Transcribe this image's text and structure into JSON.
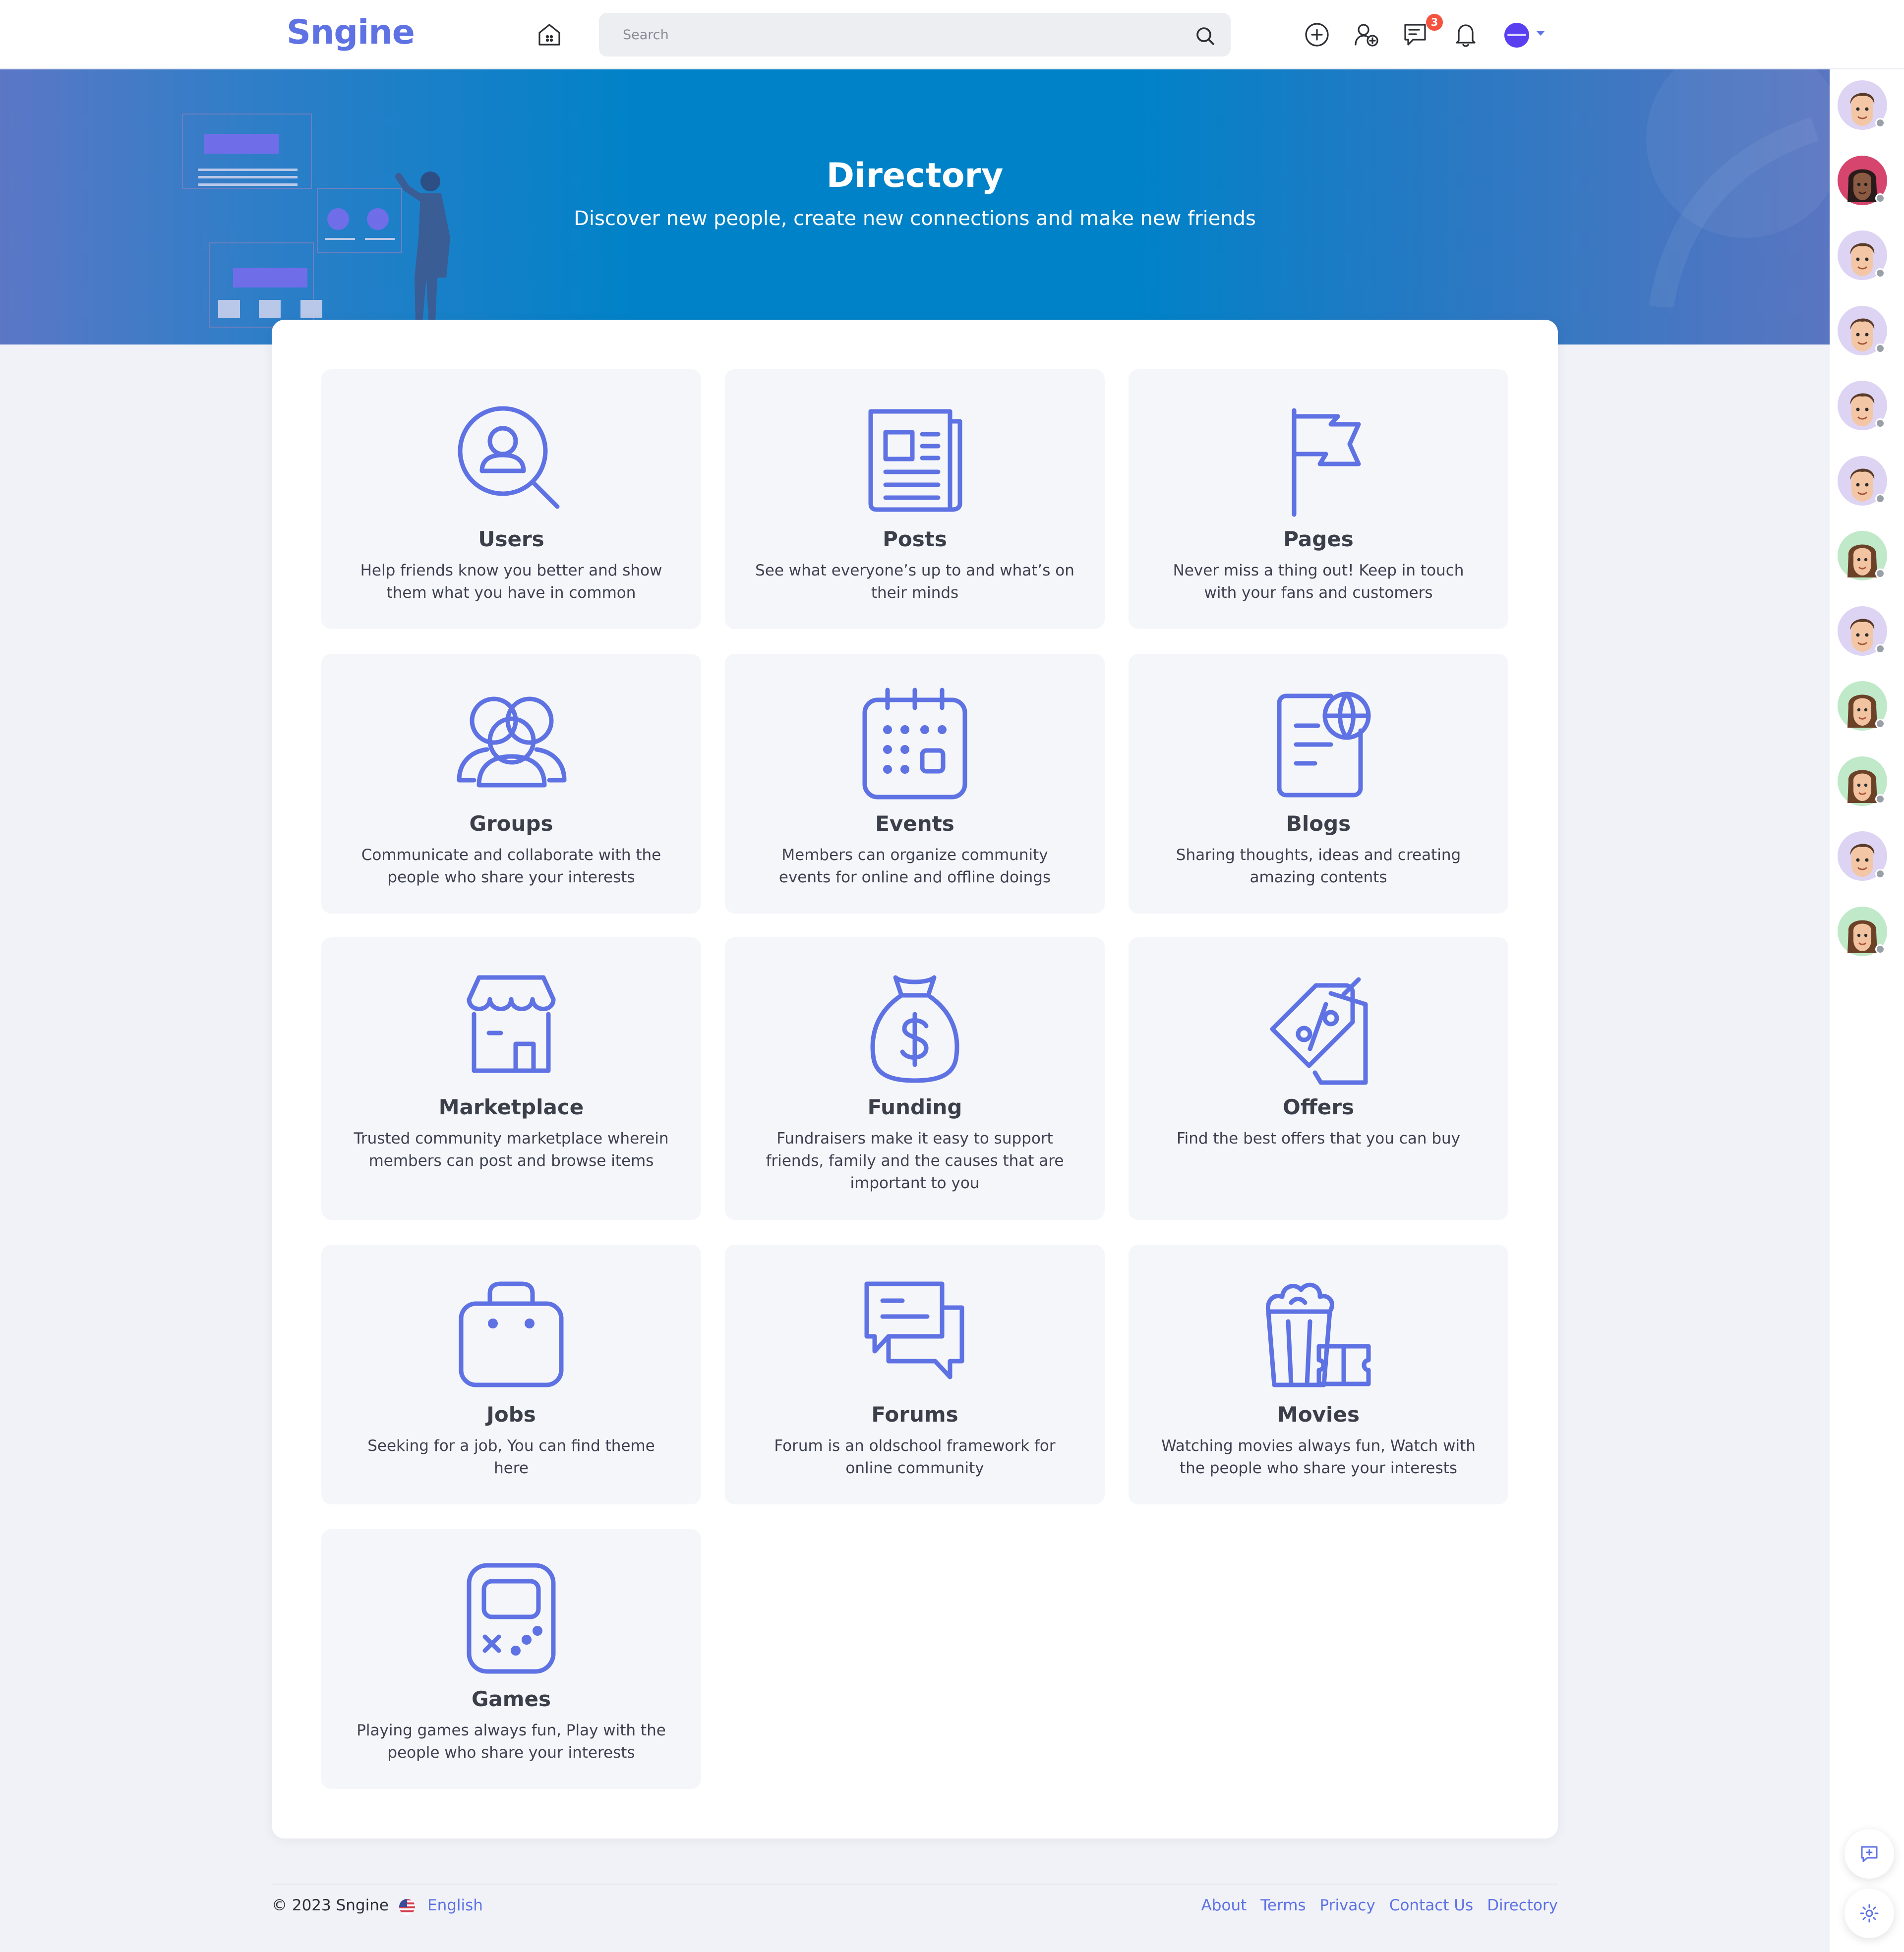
{
  "header": {
    "logo": "Sngine",
    "search_placeholder": "Search",
    "messages_badge": "3"
  },
  "hero": {
    "title": "Directory",
    "subtitle": "Discover new people, create new connections and make new friends"
  },
  "directory": [
    {
      "title": "Users",
      "desc": "Help friends know you better and show them what you have in common",
      "icon": "user-search-icon"
    },
    {
      "title": "Posts",
      "desc": "See what everyone’s up to and what’s on their minds",
      "icon": "newspaper-icon"
    },
    {
      "title": "Pages",
      "desc": "Never miss a thing out! Keep in touch with your fans and customers",
      "icon": "flag-icon"
    },
    {
      "title": "Groups",
      "desc": "Communicate and collaborate with the people who share your interests",
      "icon": "group-icon"
    },
    {
      "title": "Events",
      "desc": "Members can organize community events for online and offline doings",
      "icon": "calendar-icon"
    },
    {
      "title": "Blogs",
      "desc": "Sharing thoughts, ideas and creating amazing contents",
      "icon": "blog-globe-icon"
    },
    {
      "title": "Marketplace",
      "desc": "Trusted community marketplace wherein members can post and browse items",
      "icon": "store-icon"
    },
    {
      "title": "Funding",
      "desc": "Fundraisers make it easy to support friends, family and the causes that are important to you",
      "icon": "money-bag-icon"
    },
    {
      "title": "Offers",
      "desc": "Find the best offers that you can buy",
      "icon": "discount-tag-icon"
    },
    {
      "title": "Jobs",
      "desc": "Seeking for a job, You can find theme here",
      "icon": "briefcase-icon"
    },
    {
      "title": "Forums",
      "desc": "Forum is an oldschool framework for online community",
      "icon": "chat-bubbles-icon"
    },
    {
      "title": "Movies",
      "desc": "Watching movies always fun, Watch with the people who share your interests",
      "icon": "popcorn-ticket-icon"
    },
    {
      "title": "Games",
      "desc": "Playing games always fun, Play with the people who share your interests",
      "icon": "gamepad-icon"
    }
  ],
  "contacts": [
    {
      "type": "male",
      "bg": "#ddd3f3"
    },
    {
      "type": "female-dark",
      "bg": "#d6456d"
    },
    {
      "type": "male",
      "bg": "#ddd3f3"
    },
    {
      "type": "male",
      "bg": "#ddd3f3"
    },
    {
      "type": "male",
      "bg": "#ddd3f3"
    },
    {
      "type": "male",
      "bg": "#ddd3f3"
    },
    {
      "type": "female",
      "bg": "#bfe9c8"
    },
    {
      "type": "male",
      "bg": "#ddd3f3"
    },
    {
      "type": "female",
      "bg": "#bfe9c8"
    },
    {
      "type": "female",
      "bg": "#bfe9c8"
    },
    {
      "type": "male",
      "bg": "#ddd3f3"
    },
    {
      "type": "female",
      "bg": "#bfe9c8"
    }
  ],
  "footer": {
    "copyright": "© 2023 Sngine",
    "language": "English",
    "links": [
      "About",
      "Terms",
      "Privacy",
      "Contact Us",
      "Directory"
    ]
  },
  "colors": {
    "accent": "#5e72e4",
    "hero_blue": "#0082c8",
    "badge": "#f5533d"
  }
}
